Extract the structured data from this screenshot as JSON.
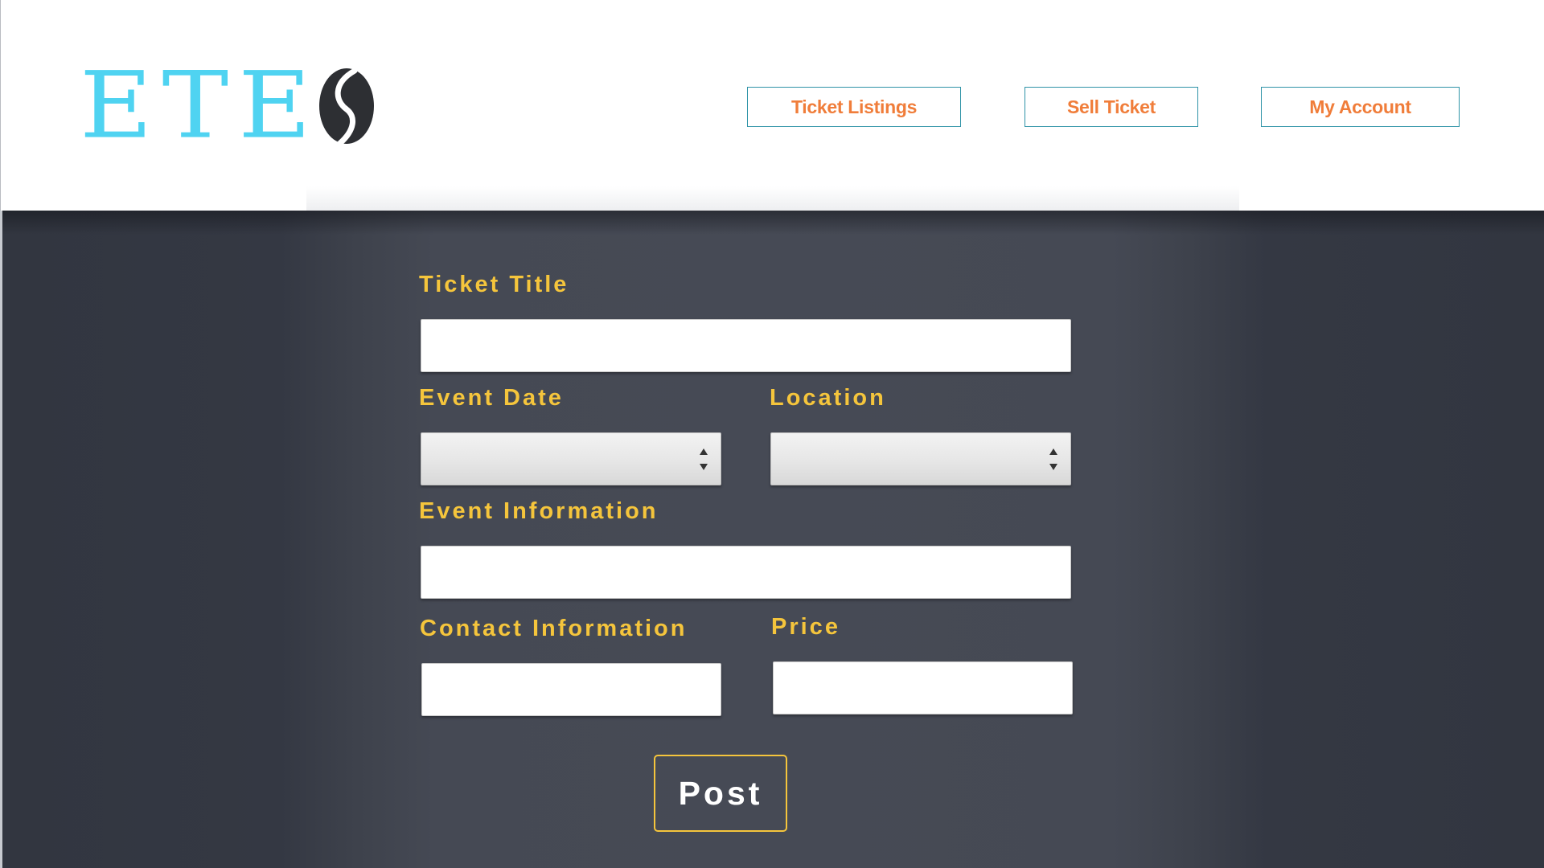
{
  "header": {
    "logo": {
      "text": "ETE",
      "mark_icon": "s-leaf-logo-icon",
      "text_color": "#4fd3f1",
      "mark_color": "#2d2f33"
    },
    "nav": {
      "ticket_listings": "Ticket Listings",
      "sell_ticket": "Sell Ticket",
      "my_account": "My Account"
    },
    "nav_text_color": "#f07d3a",
    "nav_border_color": "#2e93a7"
  },
  "form": {
    "ticket_title": {
      "label": "Ticket Title",
      "value": "",
      "placeholder": ""
    },
    "event_date": {
      "label": "Event Date",
      "selected": ""
    },
    "location": {
      "label": "Location",
      "selected": ""
    },
    "event_information": {
      "label": "Event Information",
      "value": "",
      "placeholder": ""
    },
    "contact_information": {
      "label": "Contact Information",
      "value": "",
      "placeholder": ""
    },
    "price": {
      "label": "Price",
      "value": "",
      "placeholder": ""
    },
    "post_label": "Post",
    "label_color": "#f5c53c",
    "background_color": "#464a55"
  }
}
